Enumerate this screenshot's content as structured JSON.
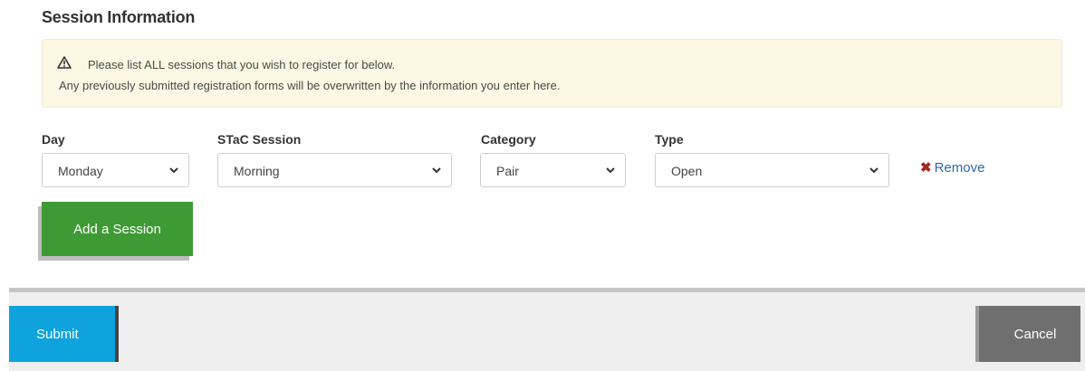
{
  "section": {
    "title": "Session Information"
  },
  "alert": {
    "icon": "warning-triangle-icon",
    "line1": "Please list ALL sessions that you wish to register for below.",
    "line2": "Any previously submitted registration forms will be overwritten by the information you enter here."
  },
  "fields": {
    "day": {
      "label": "Day",
      "value": "Monday"
    },
    "session": {
      "label": "STaC Session",
      "value": "Morning"
    },
    "category": {
      "label": "Category",
      "value": "Pair"
    },
    "type": {
      "label": "Type",
      "value": "Open"
    }
  },
  "remove": {
    "icon": "close-x-icon",
    "label": "Remove",
    "color": "#a8271e"
  },
  "add_session": {
    "label": "Add a Session",
    "color": "#3e9a35"
  },
  "footer": {
    "submit_label": "Submit",
    "submit_color": "#0ea3dd",
    "cancel_label": "Cancel",
    "cancel_color": "#6f6f6f"
  }
}
